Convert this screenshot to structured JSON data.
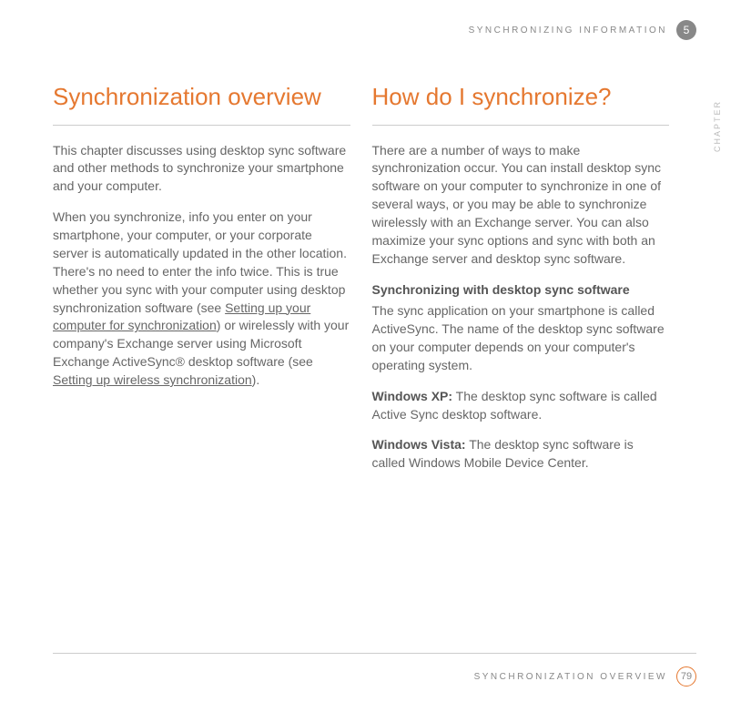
{
  "header": {
    "section_title": "SYNCHRONIZING INFORMATION",
    "chapter_number": "5",
    "chapter_label": "CHAPTER"
  },
  "left_column": {
    "heading": "Synchronization overview",
    "para1": "This chapter discusses using desktop sync software and other methods to synchronize your smartphone and your computer.",
    "para2_a": "When you synchronize, info you enter on your smartphone, your computer, or your corporate server is automatically updated in the other location. There's no need to enter the info twice. This is true whether you sync with your computer using desktop synchronization software (see ",
    "para2_link1": "Setting up your computer for synchronization",
    "para2_b": ") or wirelessly with your company's Exchange server using Microsoft Exchange ActiveSync® desktop software (see ",
    "para2_link2": "Setting up wireless synchronization",
    "para2_c": ")."
  },
  "right_column": {
    "heading": "How do I synchronize?",
    "para1": "There are a number of ways to make synchronization occur. You can install desktop sync software on your computer to synchronize in one of several ways, or you may be able to synchronize wirelessly with an Exchange server. You can also maximize your sync options and sync with both an Exchange server and desktop sync software.",
    "subheading": "Synchronizing with desktop sync software",
    "para2": "The sync application on your smartphone is called ActiveSync. The name of the desktop sync software on your computer depends on your computer's operating system.",
    "xp_label": "Windows XP:",
    "xp_text": " The desktop sync software is called Active Sync desktop software.",
    "vista_label": "Windows Vista:",
    "vista_text": " The desktop sync software is called Windows Mobile Device Center."
  },
  "footer": {
    "section_title": "SYNCHRONIZATION OVERVIEW",
    "page_number": "79"
  }
}
